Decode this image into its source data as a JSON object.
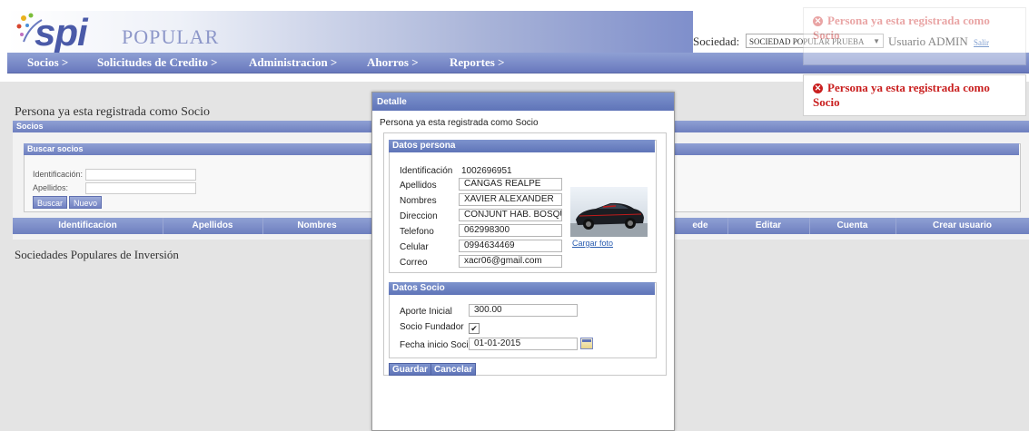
{
  "app": {
    "logo_spi": "spi",
    "logo_popular": "POPULAR",
    "sociedad_label": "Sociedad:",
    "sociedad_value": "SOCIEDAD POPULAR PRUEBA",
    "usuario_label": "Usuario ADMIN",
    "salir_label": "Salir"
  },
  "menu": [
    {
      "label": "Socios >"
    },
    {
      "label": "Solicitudes de Credito >"
    },
    {
      "label": "Administracion >"
    },
    {
      "label": "Ahorros >"
    },
    {
      "label": "Reportes >"
    }
  ],
  "toasts": {
    "faded_text": "Persona ya esta registrada como Socio",
    "main_text": "Persona ya esta registrada como Socio"
  },
  "background": {
    "message": "Persona ya esta registrada como Socio",
    "panel_title": "Socios",
    "search_title": "Buscar socios",
    "id_label": "Identificación:",
    "apellidos_label": "Apellidos:",
    "buscar_button": "Buscar",
    "nuevo_button": "Nuevo",
    "columns": [
      "Identificacion",
      "Apellidos",
      "Nombres",
      "",
      "ede",
      "Editar",
      "Cuenta",
      "Crear usuario"
    ],
    "footer": "Sociedades Populares de Inversión"
  },
  "dialog": {
    "title": "Detalle",
    "message": "Persona ya esta registrada como Socio",
    "datos_persona": {
      "header": "Datos persona",
      "identificacion_label": "Identificación",
      "identificacion_value": "1002696951",
      "apellidos_label": "Apellidos",
      "apellidos_value": "CANGAS REALPE",
      "nombres_label": "Nombres",
      "nombres_value": "XAVIER ALEXANDER",
      "direccion_label": "Direccion",
      "direccion_value": "CONJUNT HAB. BOSQUE D",
      "telefono_label": "Telefono",
      "telefono_value": "062998300",
      "celular_label": "Celular",
      "celular_value": "0994634469",
      "correo_label": "Correo",
      "correo_value": "xacr06@gmail.com",
      "cargar_foto": "Cargar foto"
    },
    "datos_socio": {
      "header": "Datos Socio",
      "aporte_label": "Aporte Inicial",
      "aporte_value": "300.00",
      "fundador_label": "Socio Fundador",
      "fundador_checked": "✔",
      "fecha_label": "Fecha inicio Socio",
      "fecha_value": "01-01-2015"
    },
    "guardar_button": "Guardar",
    "cancelar_button": "Cancelar"
  }
}
